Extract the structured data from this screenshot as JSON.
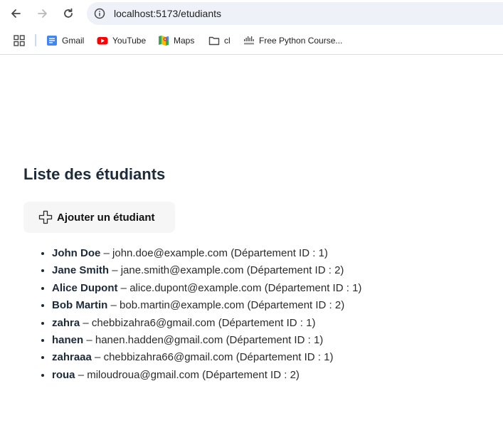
{
  "browser": {
    "url": "localhost:5173/etudiants",
    "bookmarks": [
      {
        "label": "Gmail",
        "icon": "gmail-icon"
      },
      {
        "label": "YouTube",
        "icon": "youtube-icon"
      },
      {
        "label": "Maps",
        "icon": "maps-icon"
      },
      {
        "label": "cl",
        "icon": "folder-icon"
      },
      {
        "label": "Free Python Course...",
        "icon": "cisco-icon"
      }
    ]
  },
  "page": {
    "title": "Liste des étudiants",
    "add_button_label": "Ajouter un étudiant",
    "separator": "–",
    "dept_prefix": "(Département ID : ",
    "dept_suffix": ")",
    "students": [
      {
        "name": "John Doe",
        "email": "john.doe@example.com",
        "dept": "1"
      },
      {
        "name": "Jane Smith",
        "email": "jane.smith@example.com",
        "dept": "2"
      },
      {
        "name": "Alice Dupont",
        "email": "alice.dupont@example.com",
        "dept": "1"
      },
      {
        "name": "Bob Martin",
        "email": "bob.martin@example.com",
        "dept": "2"
      },
      {
        "name": "zahra",
        "email": "chebbizahra6@gmail.com",
        "dept": "1"
      },
      {
        "name": "hanen",
        "email": "hanen.hadden@gmail.com",
        "dept": "1"
      },
      {
        "name": "zahraaa",
        "email": "chebbizahra66@gmail.com",
        "dept": "1"
      },
      {
        "name": "roua",
        "email": "miloudroua@gmail.com",
        "dept": "2"
      }
    ]
  },
  "colors": {
    "title": "#1d2a39",
    "omnibox_bg": "#eef1f8",
    "button_bg": "#f6f6f6"
  }
}
